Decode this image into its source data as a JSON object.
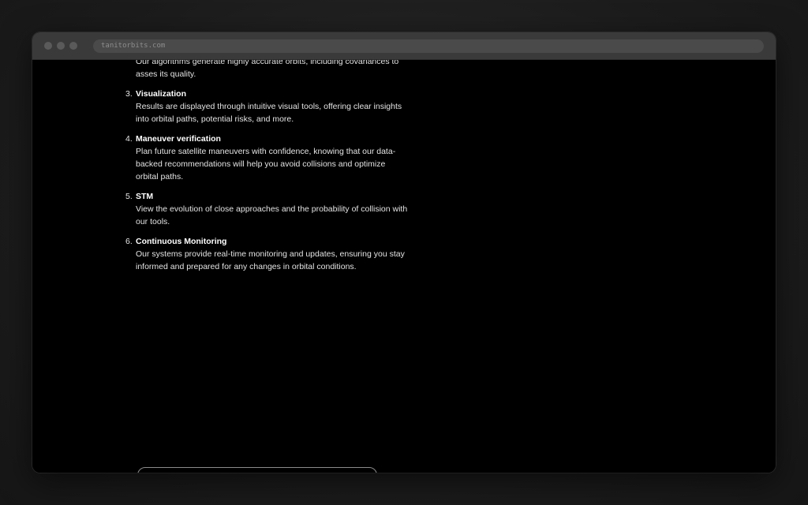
{
  "browser": {
    "url": "tanitorbits.com"
  },
  "steps": [
    {
      "number": "",
      "title": "",
      "description": "Our algorithms generate highly accurate orbits, including covariances to asses its quality."
    },
    {
      "number": "3.",
      "title": "Visualization",
      "description": "Results are displayed through intuitive visual tools, offering clear insights into orbital paths, potential risks, and more."
    },
    {
      "number": "4.",
      "title": "Maneuver verification",
      "description": "Plan future satellite maneuvers with confidence, knowing that our data-backed recommendations will help you avoid collisions and optimize orbital paths."
    },
    {
      "number": "5.",
      "title": "STM",
      "description": "View the evolution of close approaches and the probability of collision with our tools."
    },
    {
      "number": "6.",
      "title": "Continuous Monitoring",
      "description": "Our systems provide real-time monitoring and updates, ensuring you stay informed and prepared for any changes in orbital conditions."
    }
  ]
}
